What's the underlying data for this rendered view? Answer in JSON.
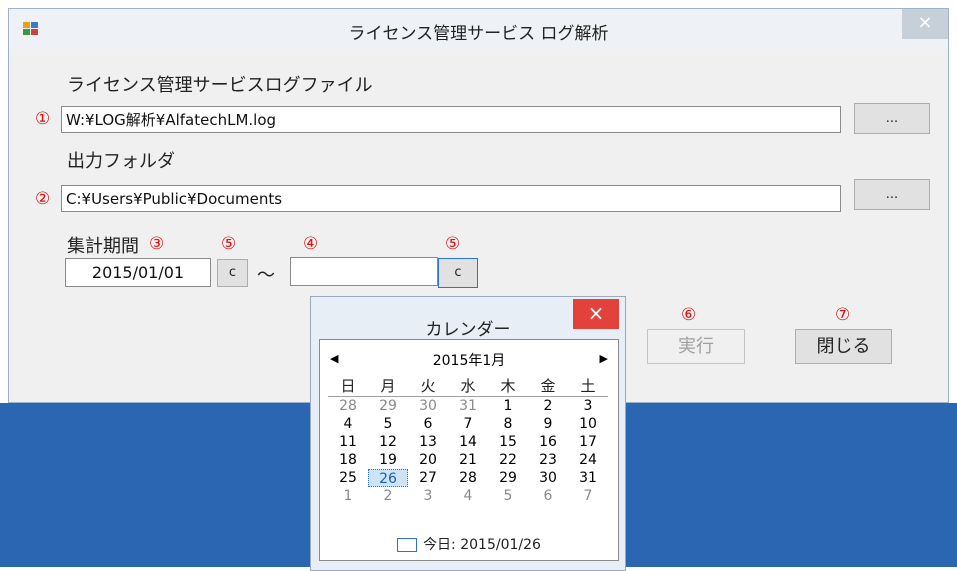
{
  "window": {
    "title": "ライセンス管理サービス ログ解析",
    "close_glyph": "×"
  },
  "form": {
    "log_label": "ライセンス管理サービスログファイル",
    "log_marker": "①",
    "log_value": "W:¥LOG解析¥AlfatechLM.log",
    "log_browse": "...",
    "folder_label": "出力フォルダ",
    "folder_marker": "②",
    "folder_value": "C:¥Users¥Public¥Documents",
    "folder_browse": "...",
    "period_label": "集計期間",
    "period_marker": "③",
    "start_marker": "⑤",
    "end_marker": "④",
    "end_btn_marker": "⑤",
    "start_date": "2015/01/01",
    "start_btn": "c",
    "tilde": "〜",
    "end_date": "",
    "end_btn": "c",
    "run_marker": "⑥",
    "run_label": "実行",
    "close_marker": "⑦",
    "close_label": "閉じる"
  },
  "calendar": {
    "title": "カレンダー",
    "close_glyph": "×",
    "prev": "◀",
    "next": "▶",
    "month": "2015年1月",
    "days_of_week": [
      "日",
      "月",
      "火",
      "水",
      "木",
      "金",
      "土"
    ],
    "weeks": [
      [
        "28",
        "29",
        "30",
        "31",
        "1",
        "2",
        "3"
      ],
      [
        "4",
        "5",
        "6",
        "7",
        "8",
        "9",
        "10"
      ],
      [
        "11",
        "12",
        "13",
        "14",
        "15",
        "16",
        "17"
      ],
      [
        "18",
        "19",
        "20",
        "21",
        "22",
        "23",
        "24"
      ],
      [
        "25",
        "26",
        "27",
        "28",
        "29",
        "30",
        "31"
      ],
      [
        "1",
        "2",
        "3",
        "4",
        "5",
        "6",
        "7"
      ]
    ],
    "today_label": "今日: 2015/01/26"
  }
}
